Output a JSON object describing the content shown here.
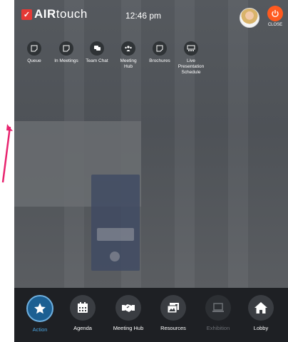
{
  "header": {
    "logo_air": "AIR",
    "logo_touch": "touch",
    "time": "12:46 pm",
    "close_label": "CLOSE"
  },
  "actions": [
    {
      "label": "Queue",
      "icon": "note-icon"
    },
    {
      "label": "In Meetings",
      "icon": "note-icon"
    },
    {
      "label": "Team Chat",
      "icon": "chat-icon"
    },
    {
      "label": "Meeting Hub",
      "icon": "people-icon"
    },
    {
      "label": "Brochures",
      "icon": "note-icon"
    },
    {
      "label": "Live Presentation Schedule",
      "icon": "presentation-icon"
    }
  ],
  "tabs": [
    {
      "label": "Action",
      "icon": "star-icon",
      "state": "active"
    },
    {
      "label": "Agenda",
      "icon": "calendar-icon",
      "state": "normal"
    },
    {
      "label": "Meeting Hub",
      "icon": "handshake-icon",
      "state": "normal"
    },
    {
      "label": "Resources",
      "icon": "images-icon",
      "state": "normal"
    },
    {
      "label": "Exhibition",
      "icon": "laptop-icon",
      "state": "disabled"
    },
    {
      "label": "Lobby",
      "icon": "home-icon",
      "state": "normal"
    }
  ],
  "colors": {
    "brand_red": "#e53935",
    "close_orange": "#ff5a1f",
    "active_blue": "#1c5f92",
    "annotation_arrow": "#e8246f"
  }
}
